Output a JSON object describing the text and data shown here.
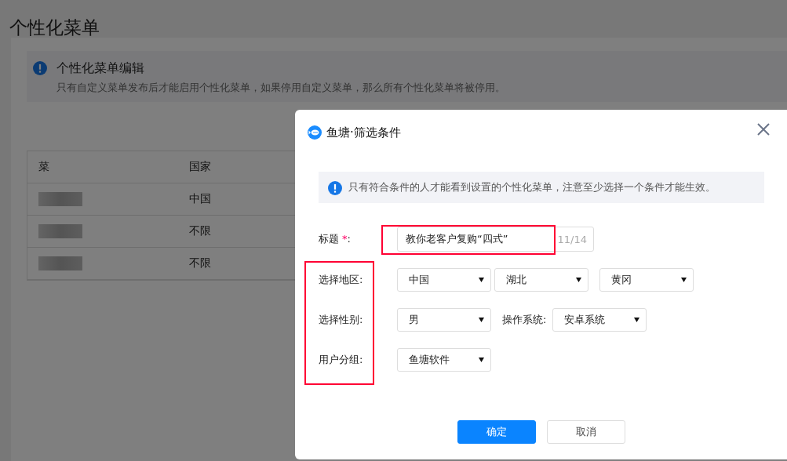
{
  "page": {
    "title": "个性化菜单",
    "notice": {
      "title": "个性化菜单编辑",
      "text": "只有自定义菜单发布后才能启用个性化菜单，如果停用自定义菜单，那么所有个性化菜单将被停用。"
    },
    "table": {
      "columns": [
        "菜",
        "国家"
      ],
      "rows": [
        {
          "country": "中国"
        },
        {
          "country": "不限"
        },
        {
          "country": "不限"
        }
      ]
    }
  },
  "dialog": {
    "title": "鱼塘·筛选条件",
    "notice": "只有符合条件的人才能看到设置的个性化菜单，注意至少选择一个条件才能生效。",
    "fields": [
      {
        "kind": "text",
        "label": "标题",
        "required_mark": "*",
        "colon": ":",
        "value": "教你老客户复购“四式”",
        "counter": "11/14",
        "highlighted": true
      },
      {
        "kind": "selects",
        "label": "选择地区:",
        "highlighted": true,
        "items": [
          {
            "kind": "select",
            "value": "中国"
          },
          {
            "kind": "select",
            "value": "湖北"
          },
          {
            "kind": "select",
            "value": "黄冈"
          }
        ]
      },
      {
        "kind": "selects",
        "label": "选择性别:",
        "highlighted": true,
        "items": [
          {
            "kind": "select",
            "value": "男"
          },
          {
            "kind": "label",
            "text": "操作系统:"
          },
          {
            "kind": "select",
            "value": "安卓系统"
          }
        ]
      },
      {
        "kind": "selects",
        "label": "用户分组:",
        "highlighted": true,
        "items": [
          {
            "kind": "select",
            "value": "鱼塘软件"
          }
        ]
      }
    ],
    "buttons": [
      {
        "label": "确定",
        "primary": true
      },
      {
        "label": "取消",
        "primary": false
      }
    ]
  }
}
